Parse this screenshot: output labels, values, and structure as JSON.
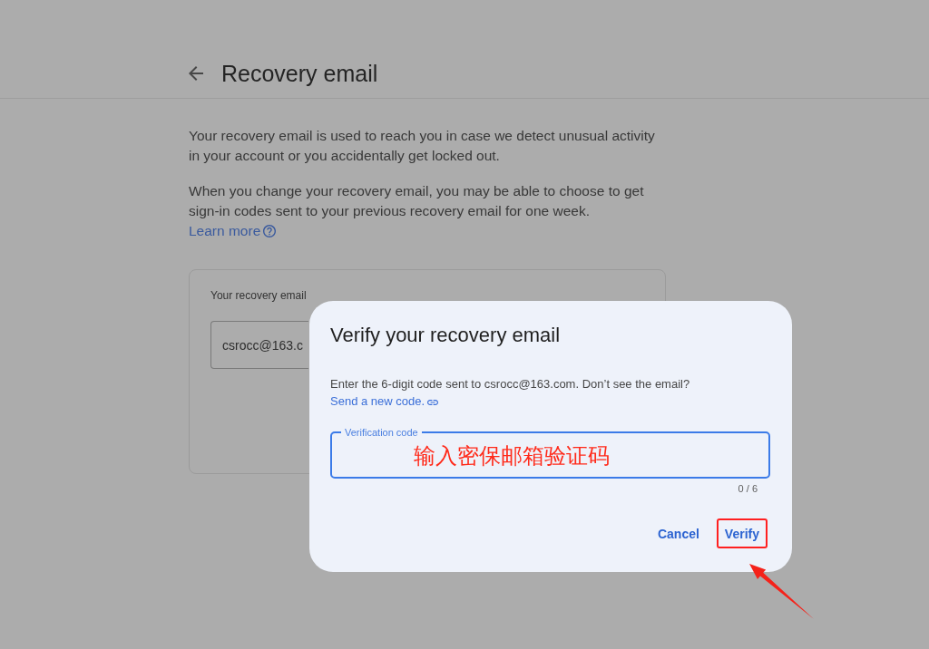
{
  "header": {
    "title": "Recovery email"
  },
  "intro": {
    "paragraphs": [
      "Your recovery email is used to reach you in case we detect unusual activity in your account or you accidentally get locked out.",
      "When you change your recovery email, you may be able to choose to get sign-in codes sent to your previous recovery email for one week."
    ],
    "link": "Learn more"
  },
  "card": {
    "label": "Your recovery email",
    "value": "csrocc@163.c"
  },
  "dialog": {
    "title": "Verify your recovery email",
    "message": "Enter the 6-digit code sent to csrocc@163.com. Don’t see the email?",
    "link": "Send a new code.",
    "field": {
      "label": "Verification code",
      "focused": true,
      "counter": "0 / 6"
    },
    "buttons": [
      {
        "label": "Cancel",
        "highlighted": false
      },
      {
        "label": "Verify",
        "highlighted": true
      }
    ]
  },
  "annotation": {
    "text": "输入密保邮箱验证码"
  }
}
